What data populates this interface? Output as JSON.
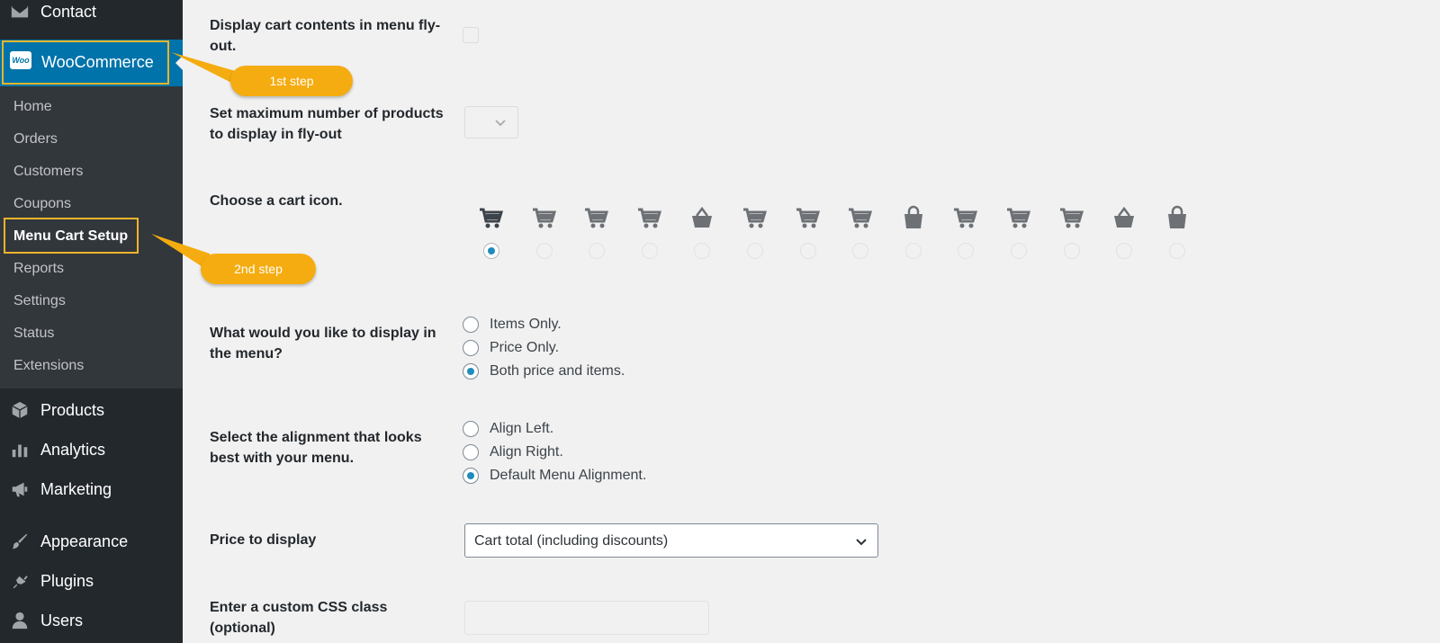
{
  "sidebar": {
    "contact": "Contact",
    "woocommerce": "WooCommerce",
    "woo_logo_text": "Woo",
    "submenu": [
      "Home",
      "Orders",
      "Customers",
      "Coupons",
      "Menu Cart Setup",
      "Reports",
      "Settings",
      "Status",
      "Extensions"
    ],
    "current_submenu": "Menu Cart Setup",
    "bottom_items": [
      "Products",
      "Analytics",
      "Marketing",
      "Appearance",
      "Plugins",
      "Users"
    ]
  },
  "callouts": {
    "first": "1st step",
    "second": "2nd step"
  },
  "settings": {
    "flyout_label": "Display cart contents in menu fly-out.",
    "max_products_label": "Set maximum number of products to display in fly-out",
    "cart_icon_label": "Choose a cart icon.",
    "cart_icons": [
      "cart-1",
      "cart-2",
      "cart-3",
      "cart-4",
      "basket-1",
      "cart-5",
      "cart-6",
      "cart-7",
      "bag-1",
      "cart-8",
      "cart-9",
      "cart-10",
      "basket-2",
      "bag-2"
    ],
    "cart_icon_selected": 0,
    "display_label": "What would you like to display in the menu?",
    "display_options": [
      "Items Only.",
      "Price Only.",
      "Both price and items."
    ],
    "display_selected": 2,
    "alignment_label": "Select the alignment that looks best with your menu.",
    "alignment_options": [
      "Align Left.",
      "Align Right.",
      "Default Menu Alignment."
    ],
    "alignment_selected": 2,
    "price_label": "Price to display",
    "price_value": "Cart total (including discounts)",
    "css_label": "Enter a custom CSS class (optional)"
  },
  "colors": {
    "accent": "#0073aa",
    "callout": "#f5ac10",
    "radio_check": "#1e8cbe"
  }
}
